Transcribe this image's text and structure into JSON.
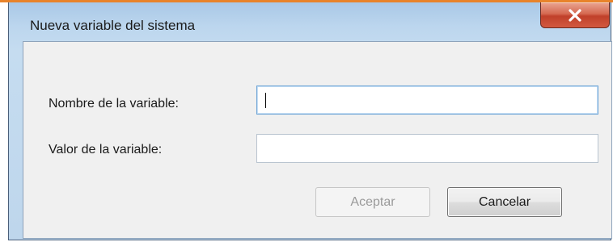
{
  "window": {
    "title": "Nueva variable del sistema",
    "close_symbol": "x",
    "accent_color": "#e8832a"
  },
  "form": {
    "name_label": "Nombre de la variable:",
    "name_value": "",
    "value_label": "Valor de la variable:",
    "value_value": ""
  },
  "buttons": {
    "ok_label": "Aceptar",
    "ok_enabled": false,
    "cancel_label": "Cancelar"
  }
}
